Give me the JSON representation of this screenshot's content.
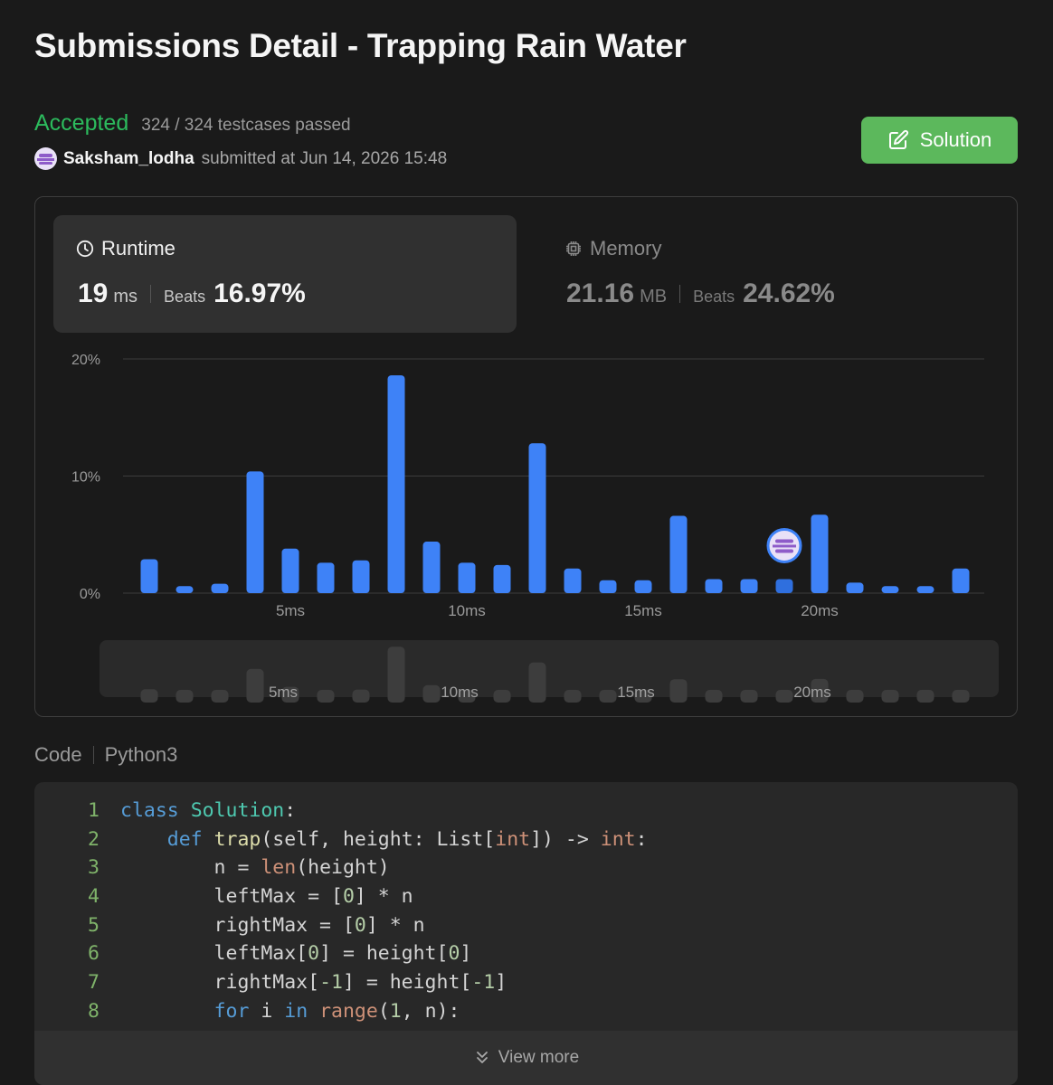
{
  "header": {
    "title": "Submissions Detail - Trapping Rain Water"
  },
  "status": {
    "result": "Accepted",
    "testcases": "324 / 324 testcases passed",
    "username": "Saksham_lodha",
    "submitted": "submitted at Jun 14, 2026 15:48",
    "solution_label": "Solution"
  },
  "runtime": {
    "label": "Runtime",
    "value": "19",
    "unit": "ms",
    "beats_label": "Beats",
    "beats": "16.97%"
  },
  "memory": {
    "label": "Memory",
    "value": "21.16",
    "unit": "MB",
    "beats_label": "Beats",
    "beats": "24.62%"
  },
  "chart_data": {
    "type": "bar",
    "title": "",
    "xlabel": "",
    "ylabel": "",
    "x": [
      1,
      2,
      3,
      4,
      5,
      6,
      7,
      8,
      9,
      10,
      11,
      12,
      13,
      14,
      15,
      16,
      17,
      18,
      19,
      20,
      21,
      22,
      23,
      24
    ],
    "values": [
      2.9,
      0.6,
      0.8,
      10.4,
      3.8,
      2.6,
      2.8,
      18.6,
      4.4,
      2.6,
      2.4,
      12.8,
      2.1,
      1.1,
      1.1,
      6.6,
      1.2,
      1.2,
      1.2,
      6.7,
      0.9,
      0.6,
      0.6,
      2.1
    ],
    "ylim": [
      0,
      20
    ],
    "y_ticks": [
      "0%",
      "10%",
      "20%"
    ],
    "x_ticks": [
      "5ms",
      "10ms",
      "15ms",
      "20ms"
    ],
    "highlighted_x": 19,
    "grid": true,
    "colors": {
      "bar": "#3e82f7",
      "highlight": "#2f6fde",
      "grid": "#3c3c3c",
      "overview_bar": "#3d3d3d"
    }
  },
  "code": {
    "label": "Code",
    "language": "Python3",
    "line_numbers": [
      "1",
      "2",
      "3",
      "4",
      "5",
      "6",
      "7",
      "8"
    ],
    "view_more": "View more"
  },
  "icons": {
    "clock": "clock-icon",
    "chip": "chip-icon",
    "edit": "edit-icon",
    "chevrons": "chevrons-down-icon"
  }
}
